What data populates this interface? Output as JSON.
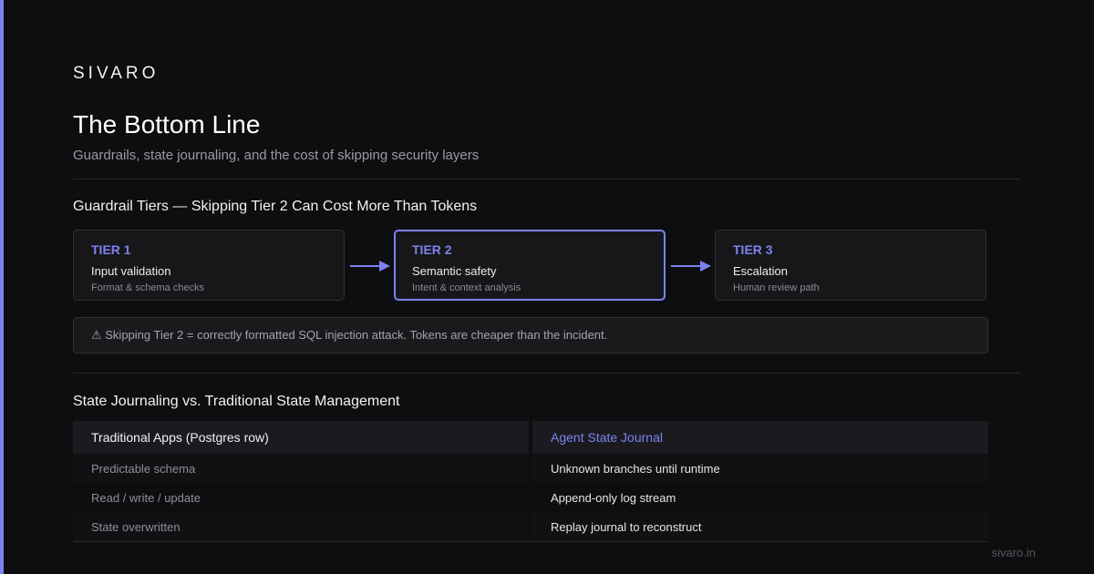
{
  "brand": "SIVARO",
  "title": "The Bottom Line",
  "subtitle": "Guardrails, state journaling, and the cost of skipping security layers",
  "guardrails": {
    "heading": "Guardrail Tiers — Skipping Tier 2 Can Cost More Than Tokens",
    "tiers": [
      {
        "label": "TIER 1",
        "name": "Input validation",
        "desc": "Format & schema checks"
      },
      {
        "label": "TIER 2",
        "name": "Semantic safety",
        "desc": "Intent & context analysis"
      },
      {
        "label": "TIER 3",
        "name": "Escalation",
        "desc": "Human review path"
      }
    ],
    "warning": "⚠ Skipping Tier 2 = correctly formatted SQL injection attack. Tokens are cheaper than the incident."
  },
  "state": {
    "heading": "State Journaling vs. Traditional State Management",
    "headers": [
      "Traditional Apps (Postgres row)",
      "Agent State Journal"
    ],
    "rows": [
      [
        "Predictable schema",
        "Unknown branches until runtime"
      ],
      [
        "Read / write / update",
        "Append-only log stream"
      ],
      [
        "State overwritten",
        "Replay journal to reconstruct"
      ]
    ]
  },
  "footer": "sivaro.in",
  "colors": {
    "accent": "#7c83f0",
    "background": "#0e0e10"
  }
}
